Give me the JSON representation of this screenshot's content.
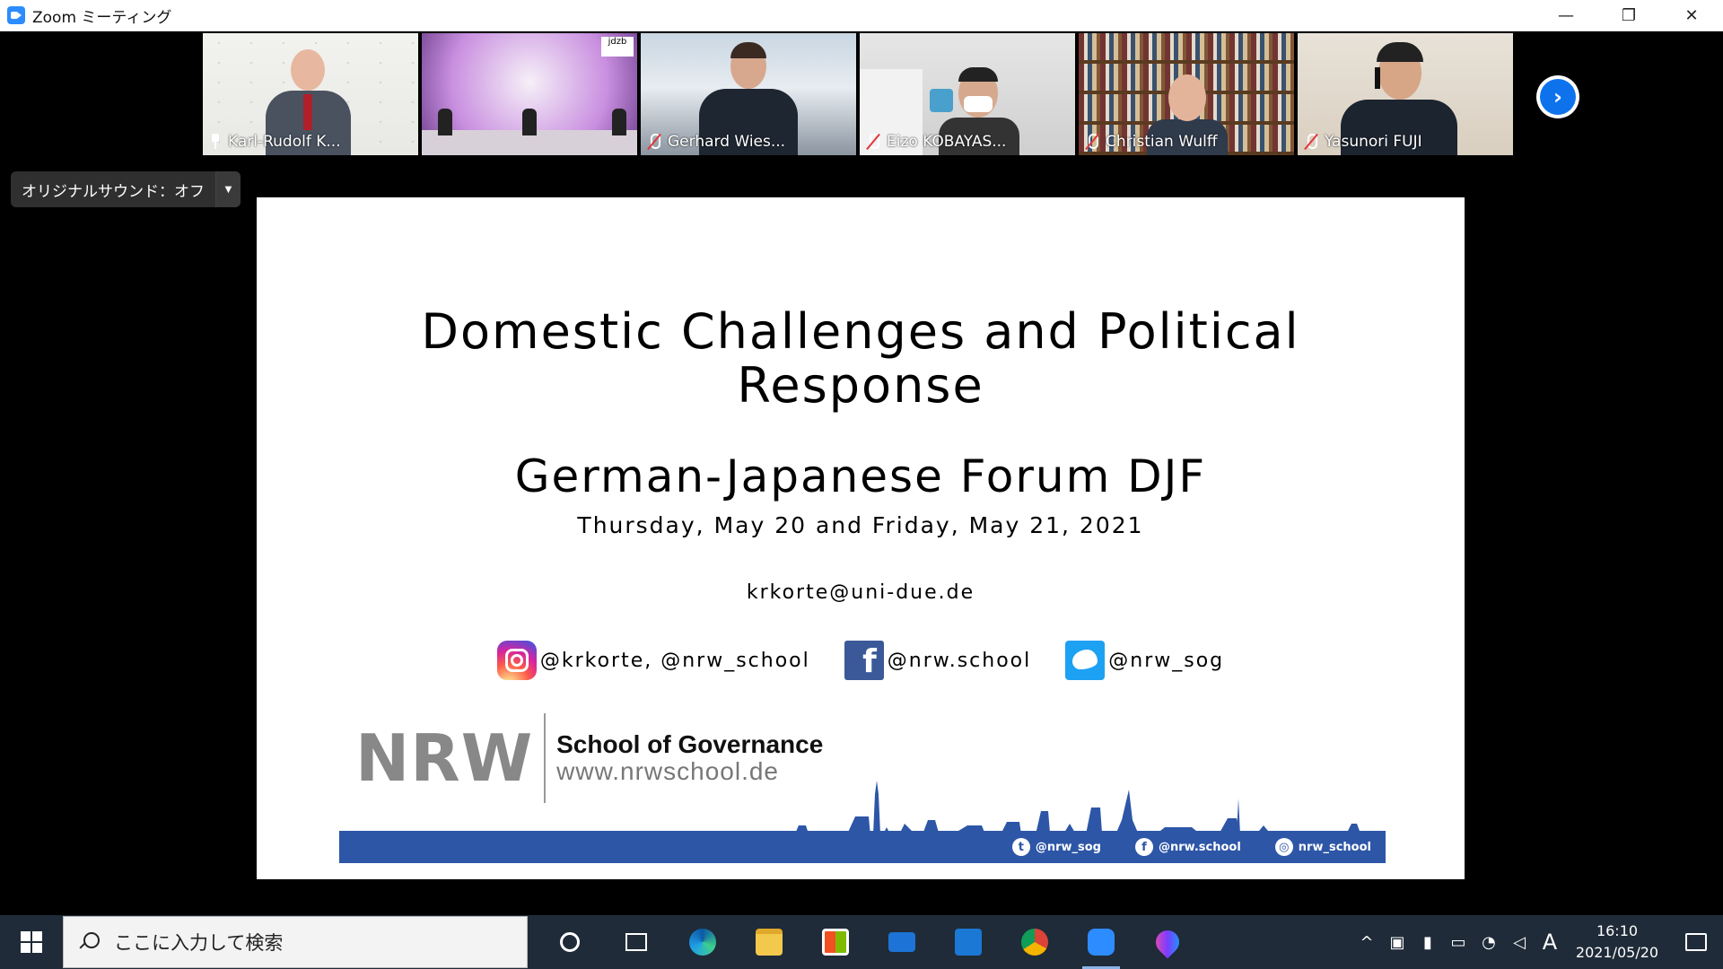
{
  "window": {
    "title": "Zoom ミーティング",
    "controls": {
      "minimize": "—",
      "restore": "❐",
      "close": "✕"
    }
  },
  "participants": [
    {
      "name": "Karl-Rudolf K...",
      "pinned": true,
      "muted": false,
      "active": true
    },
    {
      "name": "",
      "pinned": false,
      "muted": false,
      "active": false,
      "overlay_text": "jdzb"
    },
    {
      "name": "Gerhard Wies...",
      "pinned": false,
      "muted": true,
      "active": false
    },
    {
      "name": "Eizo KOBAYAS...",
      "pinned": false,
      "muted": true,
      "active": false
    },
    {
      "name": "Christian Wulff",
      "pinned": false,
      "muted": true,
      "active": false
    },
    {
      "name": "Yasunori FUJI",
      "pinned": false,
      "muted": true,
      "active": false
    }
  ],
  "original_sound": {
    "label": "オリジナルサウンド：オフ",
    "dropdown": "▼"
  },
  "next_page": "›",
  "slide": {
    "title_line1": "Domestic Challenges and Political",
    "title_line2": "Response",
    "subtitle": "German-Japanese Forum DJF",
    "date": "Thursday, May 20 and Friday, May 21, 2021",
    "email": "krkorte@uni-due.de",
    "socials": [
      {
        "icon": "instagram-icon",
        "text": "@krkorte, @nrw_school"
      },
      {
        "icon": "facebook-icon",
        "text": "@nrw.school"
      },
      {
        "icon": "twitter-icon",
        "text": "@nrw_sog"
      }
    ],
    "logo": {
      "big": "NRW",
      "line1": "School of Governance",
      "line2": "www.nrwschool.de"
    },
    "bar": [
      {
        "icon": "twitter-icon",
        "text": "@nrw_sog"
      },
      {
        "icon": "facebook-icon",
        "text": "@nrw.school"
      },
      {
        "icon": "instagram-icon",
        "text": "nrw_school"
      }
    ],
    "colors": {
      "nrw_blue": "#2d56a7"
    }
  },
  "taskbar": {
    "search_placeholder": "ここに入力して検索",
    "clock_time": "16:10",
    "clock_date": "2021/05/20",
    "ime": "A",
    "tray_chevron": "^"
  }
}
